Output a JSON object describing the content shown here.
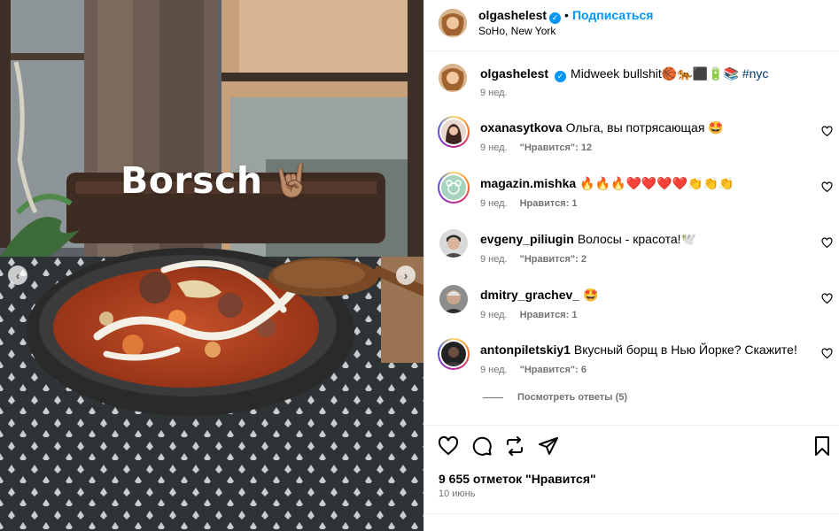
{
  "post": {
    "caption_overlay": "Borsch",
    "caption_overlay_emoji": "🤘🏽"
  },
  "header": {
    "username": "olgashelest",
    "separator": "•",
    "follow_label": "Подписаться",
    "location": "SoHo, New York"
  },
  "caption": {
    "username": "olgashelest",
    "text": "Midweek bullshit🏀🐅⬛🔋📚",
    "hashtag": "#nyc",
    "time": "9 нед."
  },
  "comments": [
    {
      "username": "oxanasytkova",
      "text": "Ольга, вы потрясающая 🤩",
      "time": "9 нед.",
      "likes": "\"Нравится\": 12"
    },
    {
      "username": "magazin.mishka",
      "text": "🔥🔥🔥❤️❤️❤️❤️👏👏👏",
      "time": "9 нед.",
      "likes": "Нравится: 1"
    },
    {
      "username": "evgeny_piliugin",
      "text": "Волосы - красота!🕊️",
      "time": "9 нед.",
      "likes": "\"Нравится\": 2"
    },
    {
      "username": "dmitry_grachev_",
      "text": "🤩",
      "time": "9 нед.",
      "likes": "Нравится: 1"
    },
    {
      "username": "antonpiletskiy1",
      "text": "Вкусный борщ в Нью Йорке? Скажите!",
      "time": "9 нед.",
      "likes": "\"Нравится\": 6"
    }
  ],
  "view_replies": "Посмотреть ответы (5)",
  "actions": {
    "likes_count": "9 655 отметок \"Нравится\"",
    "date": "10 июнь"
  },
  "icons": {
    "verified": "verified-badge-icon",
    "like": "heart-icon",
    "comment": "comment-icon",
    "share": "share-icon",
    "repost": "repost-icon",
    "save": "bookmark-icon",
    "prev": "chevron-left-icon",
    "next": "chevron-right-icon"
  },
  "colors": {
    "accent": "#0095f6",
    "muted": "#737373",
    "hashtag": "#00376b"
  }
}
